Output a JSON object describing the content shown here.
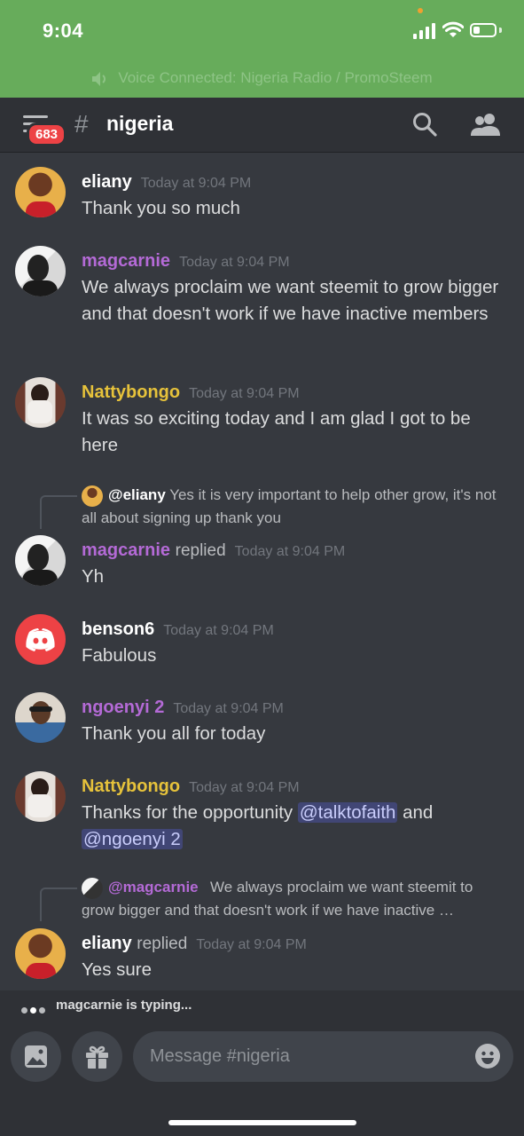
{
  "status": {
    "time": "9:04"
  },
  "voice": {
    "text": "Voice Connected: Nigeria Radio / PromoSteem"
  },
  "header": {
    "unread_badge": "683",
    "channel_name": "nigeria"
  },
  "messages": [
    {
      "author": "eliany",
      "timestamp": "Today at 9:04 PM",
      "text": "Thank you so much"
    },
    {
      "author": "magcarnie",
      "timestamp": "Today at 9:04 PM",
      "text": "We always proclaim we want steemit to grow bigger and that doesn't work if we have inactive members"
    },
    {
      "author": "Nattybongo",
      "timestamp": "Today at 9:04 PM",
      "text": "It was so exciting today and I am glad I got to be here"
    },
    {
      "reply_to_user": "@eliany",
      "reply_to_text": "Yes it is very important to help other grow, it's not all about signing up thank you",
      "author": "magcarnie",
      "replied_label": "replied",
      "timestamp": "Today at 9:04 PM",
      "text": "Yh"
    },
    {
      "author": "benson6",
      "timestamp": "Today at 9:04 PM",
      "text": "Fabulous"
    },
    {
      "author": "ngoenyi 2",
      "timestamp": "Today at 9:04 PM",
      "text": "Thank you all for today"
    },
    {
      "author": "Nattybongo",
      "timestamp": "Today at 9:04 PM",
      "text_before": "Thanks for the opportunity ",
      "mention1": "@talktofaith",
      "text_mid": " and",
      "mention2": "@ngoenyi 2"
    },
    {
      "reply_to_user": "@magcarnie",
      "reply_to_text": "We always proclaim we want steemit to grow bigger and that doesn't work if we have inactive …",
      "author": "eliany",
      "replied_label": "replied",
      "timestamp": "Today at 9:04 PM",
      "text": "Yes sure"
    }
  ],
  "typing": {
    "text": "magcarnie is typing..."
  },
  "composer": {
    "placeholder": "Message #nigeria"
  },
  "colors": {
    "voice_bar": "#67ac5b",
    "background": "#36393f",
    "mention_bg": "#414675",
    "role_purple": "#b46ad6",
    "role_gold": "#e6c23b",
    "badge_red": "#ed4245"
  },
  "icons": [
    "hamburger-icon",
    "search-icon",
    "members-icon",
    "image-icon",
    "gift-icon",
    "emoji-icon",
    "speaker-icon",
    "discord-logo-icon"
  ]
}
